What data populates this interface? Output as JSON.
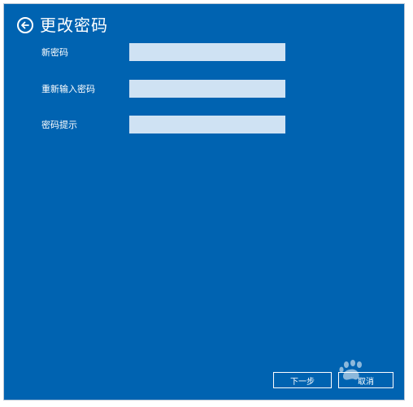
{
  "header": {
    "title": "更改密码",
    "back_icon": "back-arrow-circle-icon"
  },
  "form": {
    "fields": [
      {
        "label": "新密码",
        "value": "",
        "placeholder": ""
      },
      {
        "label": "重新输入密码",
        "value": "",
        "placeholder": ""
      },
      {
        "label": "密码提示",
        "value": "",
        "placeholder": ""
      }
    ]
  },
  "footer": {
    "next_label": "下一步",
    "cancel_label": "取消"
  },
  "colors": {
    "background": "#0063b1",
    "field": "#cfe2f3",
    "text": "#ffffff"
  }
}
